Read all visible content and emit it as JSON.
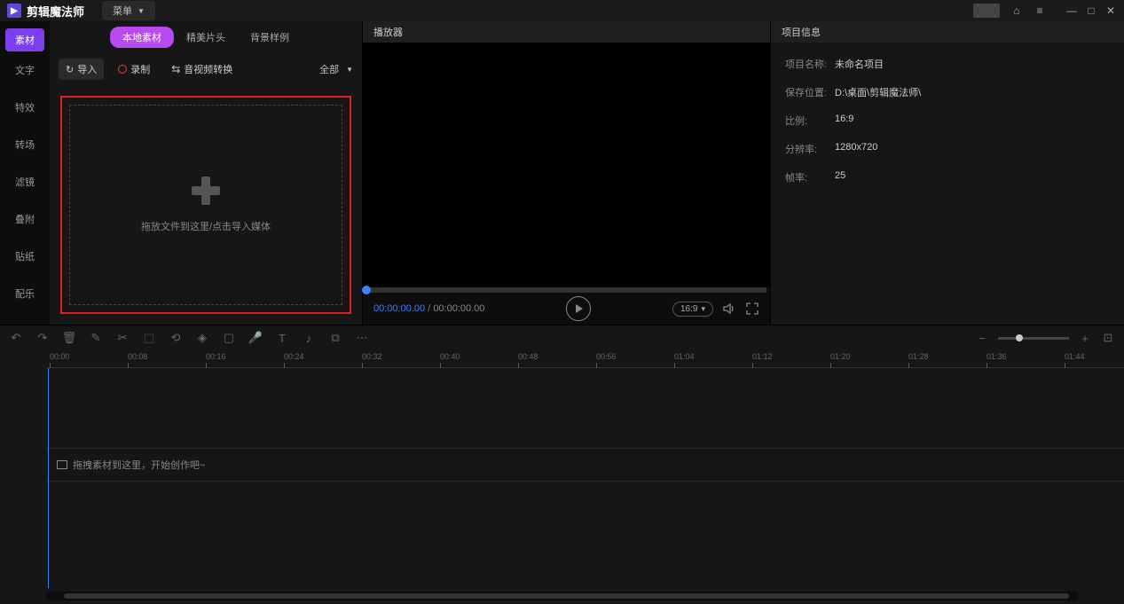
{
  "app": {
    "title": "剪辑魔法师",
    "menu_label": "菜单"
  },
  "side_tabs": [
    "素材",
    "文字",
    "特效",
    "转场",
    "滤镜",
    "叠附",
    "贴纸",
    "配乐"
  ],
  "sub_tabs": [
    "本地素材",
    "精美片头",
    "背景样例"
  ],
  "toolbar": {
    "import": "导入",
    "record": "录制",
    "convert": "音视频转换",
    "filter": "全部"
  },
  "dropzone": {
    "text": "拖放文件到这里/点击导入媒体"
  },
  "player": {
    "header": "播放器",
    "time_current": "00:00:00.00",
    "time_total": "00:00:00.00",
    "ratio": "16:9"
  },
  "info": {
    "header": "项目信息",
    "rows": [
      {
        "label": "项目名称:",
        "value": "未命名项目"
      },
      {
        "label": "保存位置:",
        "value": "D:\\桌面\\剪辑魔法师\\"
      },
      {
        "label": "比例:",
        "value": "16:9"
      },
      {
        "label": "分辨率:",
        "value": "1280x720"
      },
      {
        "label": "帧率:",
        "value": "25"
      }
    ]
  },
  "timeline": {
    "ticks": [
      "00:00",
      "00:08",
      "00:16",
      "00:24",
      "00:32",
      "00:40",
      "00:48",
      "00:56",
      "01:04",
      "01:12",
      "01:20",
      "01:28",
      "01:36",
      "01:44"
    ],
    "hint": "拖拽素材到这里，开始创作吧~"
  }
}
